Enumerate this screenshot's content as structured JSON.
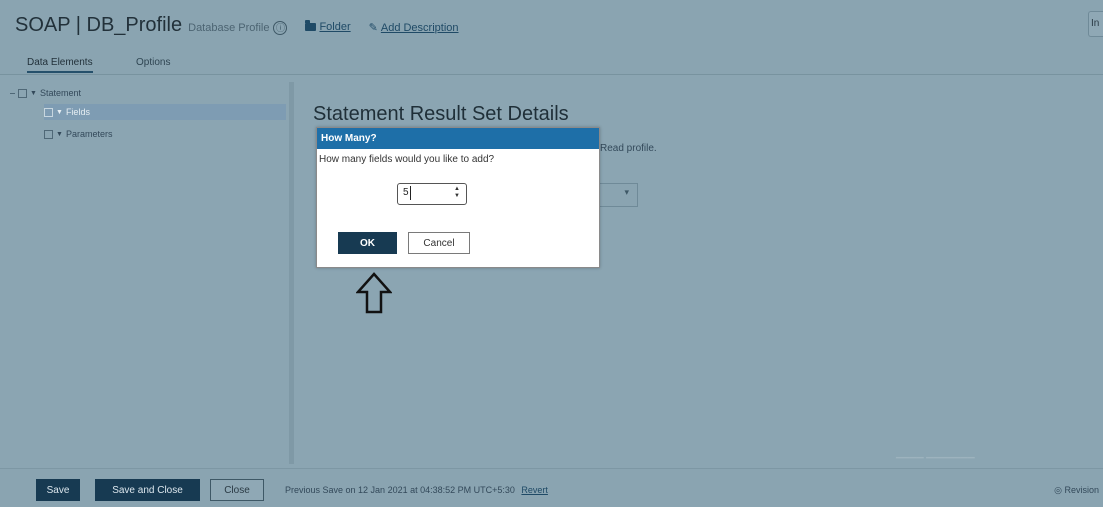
{
  "window": {
    "title": "SOAP | DB_Profile",
    "subtitle": "Database Profile",
    "info_icon": "ⓘ",
    "folder_link": "Folder",
    "add_description_link": "Add Description",
    "user_button": "In"
  },
  "tabs": [
    {
      "label": "Data Elements",
      "active": true
    },
    {
      "label": "Options",
      "active": false
    }
  ],
  "tree": {
    "statement": "Statement",
    "fields": "Fields",
    "parameters": "Parameters"
  },
  "content": {
    "title": "Statement Result Set Details",
    "description_fragment": "Read profile."
  },
  "dialog": {
    "title": "How Many?",
    "message": "How many fields would you like to add?",
    "value": "5",
    "ok_label": "OK",
    "cancel_label": "Cancel"
  },
  "footer": {
    "save_label": "Save",
    "save_close_label": "Save and Close",
    "close_label": "Close",
    "previous_save_text": "Previous Save on 12 Jan 2021 at 04:38:52 PM UTC+5:30",
    "revert_label": "Revert",
    "right_text": "Revision"
  },
  "colors": {
    "dialog_header": "#1e6fa8",
    "primary_button": "#173a52",
    "overlay_background": "#8ba5b2"
  },
  "icons": [
    "info-icon",
    "folder-icon",
    "pencil-icon",
    "expand-triangle-icon",
    "spinner-arrows-icon",
    "up-arrow-icon",
    "revision-icon"
  ]
}
